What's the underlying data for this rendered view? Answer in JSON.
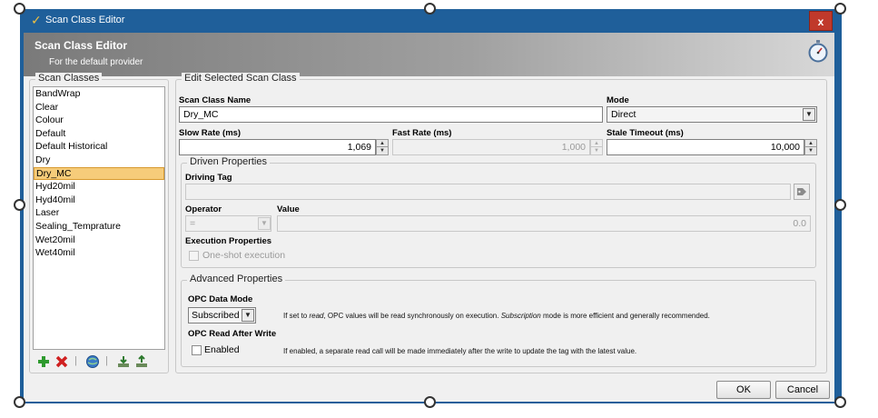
{
  "window": {
    "title": "Scan Class Editor",
    "close_label": "x"
  },
  "header": {
    "title": "Scan Class Editor",
    "subtitle": "For the default provider"
  },
  "scan_classes": {
    "legend": "Scan Classes",
    "items": [
      {
        "label": "BandWrap"
      },
      {
        "label": "Clear"
      },
      {
        "label": "Colour"
      },
      {
        "label": "Default"
      },
      {
        "label": "Default Historical"
      },
      {
        "label": "Dry"
      },
      {
        "label": "Dry_MC"
      },
      {
        "label": "Hyd20mil"
      },
      {
        "label": "Hyd40mil"
      },
      {
        "label": "Laser"
      },
      {
        "label": "Sealing_Temprature"
      },
      {
        "label": "Wet20mil"
      },
      {
        "label": "Wet40mil"
      }
    ],
    "selected": "Dry_MC"
  },
  "edit": {
    "legend": "Edit Selected Scan Class",
    "name_label": "Scan Class Name",
    "name_value": "Dry_MC",
    "mode_label": "Mode",
    "mode_value": "Direct",
    "slow_label": "Slow Rate (ms)",
    "slow_value": "1,069",
    "fast_label": "Fast Rate (ms)",
    "fast_value": "1,000",
    "stale_label": "Stale Timeout (ms)",
    "stale_value": "10,000"
  },
  "driven": {
    "legend": "Driven Properties",
    "driving_tag_label": "Driving Tag",
    "driving_tag_value": "",
    "operator_label": "Operator",
    "operator_value": "=",
    "value_label": "Value",
    "value_value": "0.0",
    "exec_label": "Execution Properties",
    "one_shot_label": "One-shot execution"
  },
  "advanced": {
    "legend": "Advanced Properties",
    "opc_mode_label": "OPC Data Mode",
    "opc_mode_value": "Subscribed",
    "opc_mode_hint_1": "If set to ",
    "opc_mode_hint_read": "read",
    "opc_mode_hint_2": ", OPC values will be read synchronously on execution. ",
    "opc_mode_hint_sub": "Subscription",
    "opc_mode_hint_3": " mode is more efficient and generally recommended.",
    "read_after_label": "OPC Read After Write",
    "enabled_label": "Enabled",
    "read_after_hint": "If enabled, a separate read call will be made immediately after the write to update the tag with the latest value."
  },
  "buttons": {
    "ok": "OK",
    "cancel": "Cancel"
  },
  "colors": {
    "title_bar": "#1f5f9a",
    "selection": "#f6cc7a",
    "close": "#c0392b"
  },
  "icons": [
    "add-icon",
    "delete-icon",
    "globe-icon",
    "import-icon",
    "export-icon",
    "tag-icon",
    "stopwatch-icon"
  ]
}
